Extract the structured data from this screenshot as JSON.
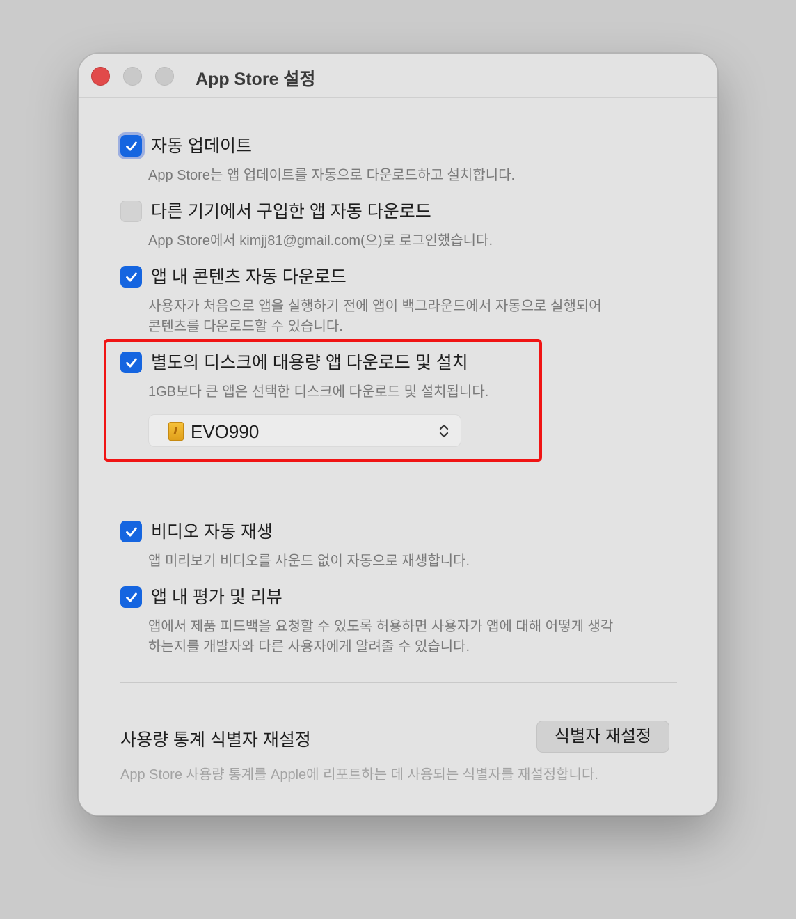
{
  "window": {
    "title": "App Store 설정"
  },
  "options": [
    {
      "label": "자동 업데이트",
      "desc": [
        "App Store는 앱 업데이트를 자동으로 다운로드하고 설치합니다."
      ],
      "checked": true
    },
    {
      "label": "다른 기기에서 구입한 앱 자동 다운로드",
      "desc": [
        "App Store에서 kimjj81@gmail.com(으)로 로그인했습니다."
      ],
      "checked": false
    },
    {
      "label": "앱 내 콘텐츠 자동 다운로드",
      "desc": [
        "사용자가 처음으로 앱을 실행하기 전에 앱이 백그라운드에서 자동으로 실행되어",
        "콘텐츠를 다운로드할 수 있습니다."
      ],
      "checked": true
    },
    {
      "label": "별도의 디스크에 대용량 앱 다운로드 및 설치",
      "desc": [
        "1GB보다 큰 앱은 선택한 디스크에 다운로드 및 설치됩니다."
      ],
      "checked": true
    },
    {
      "label": "비디오 자동 재생",
      "desc": [
        "앱 미리보기 비디오를 사운드 없이 자동으로 재생합니다."
      ],
      "checked": true
    },
    {
      "label": "앱 내 평가 및 리뷰",
      "desc": [
        "앱에서 제품 피드백을 요청할 수 있도록 허용하면 사용자가 앱에 대해 어떻게 생각",
        "하는지를 개발자와 다른 사용자에게 알려줄 수 있습니다."
      ],
      "checked": true
    }
  ],
  "disk_select": {
    "value": "EVO990"
  },
  "reset": {
    "label": "사용량 통계 식별자 재설정",
    "button": "식별자 재설정",
    "desc": "App Store 사용량 통계를 Apple에 리포트하는 데 사용되는 식별자를 재설정합니다."
  },
  "colors": {
    "accent": "#1565e0",
    "highlight": "#f01414"
  }
}
